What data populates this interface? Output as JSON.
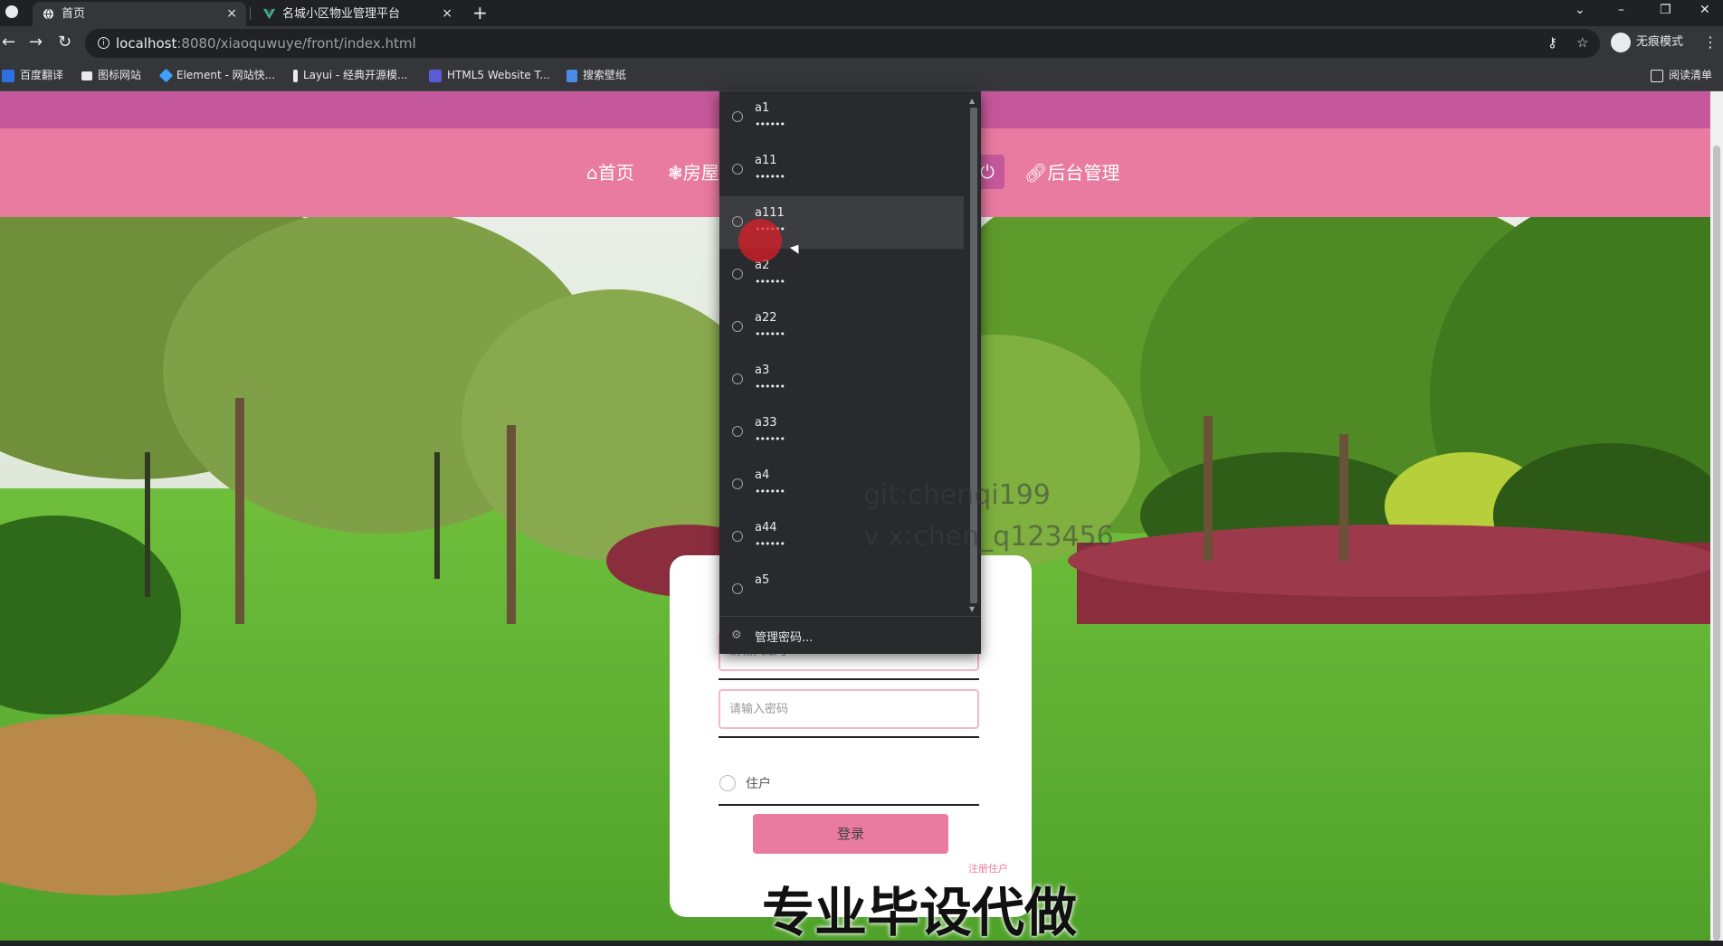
{
  "browser": {
    "tabs": [
      {
        "title": "首页",
        "active": true,
        "close": "×"
      },
      {
        "title": "名城小区物业管理平台",
        "active": false,
        "close": "×"
      }
    ],
    "new_tab": "+",
    "window_controls": {
      "collapse": "⌄",
      "minimize": "–",
      "restore": "❐",
      "close": "✕"
    },
    "nav": {
      "back": "←",
      "forward": "→",
      "reload": "↻"
    },
    "url_host": "localhost",
    "url_rest": ":8080/xiaoquwuye/front/index.html",
    "key_icon": "⚷",
    "star_icon": "☆",
    "incognito_label": "无痕模式",
    "menu": "⋮",
    "bookmarks": [
      "百度翻译",
      "图标网站",
      "Element - 网站快...",
      "Layui - 经典开源模...",
      "HTML5 Website T...",
      "搜索壁纸"
    ],
    "reading_list": "阅读清单"
  },
  "site": {
    "nav_items": [
      {
        "icon": "⌂",
        "label": "首页"
      },
      {
        "icon": "❃",
        "label": "房屋"
      },
      {
        "icon": "⏻",
        "label": ""
      },
      {
        "icon": "🔗︎",
        "label": "后台管理"
      }
    ]
  },
  "login": {
    "account_placeholder": "请输入账号",
    "password_placeholder": "请输入密码",
    "role_option": "住户",
    "submit_label": "登录",
    "register_link": "注册住户"
  },
  "autofill": {
    "items": [
      {
        "user": "a1",
        "pass": "••••••"
      },
      {
        "user": "a11",
        "pass": "••••••"
      },
      {
        "user": "a111",
        "pass": "••••••"
      },
      {
        "user": "a2",
        "pass": "••••••"
      },
      {
        "user": "a22",
        "pass": "••••••"
      },
      {
        "user": "a3",
        "pass": "••••••"
      },
      {
        "user": "a33",
        "pass": "••••••"
      },
      {
        "user": "a4",
        "pass": "••••••"
      },
      {
        "user": "a44",
        "pass": "••••••"
      },
      {
        "user": "a5",
        "pass": ""
      }
    ],
    "hovered_index": 2,
    "manage_label": "管理密码...",
    "gear_icon": "⚙"
  },
  "watermark": {
    "line1": "git:chenqi199",
    "line2": "v x:chen_q123456"
  },
  "banner": "专业毕设代做",
  "colors": {
    "top_bar": "#c4589a",
    "nav_bar": "#e97aa0",
    "button": "#e97aa0",
    "field_border": "#f3b6cf"
  }
}
